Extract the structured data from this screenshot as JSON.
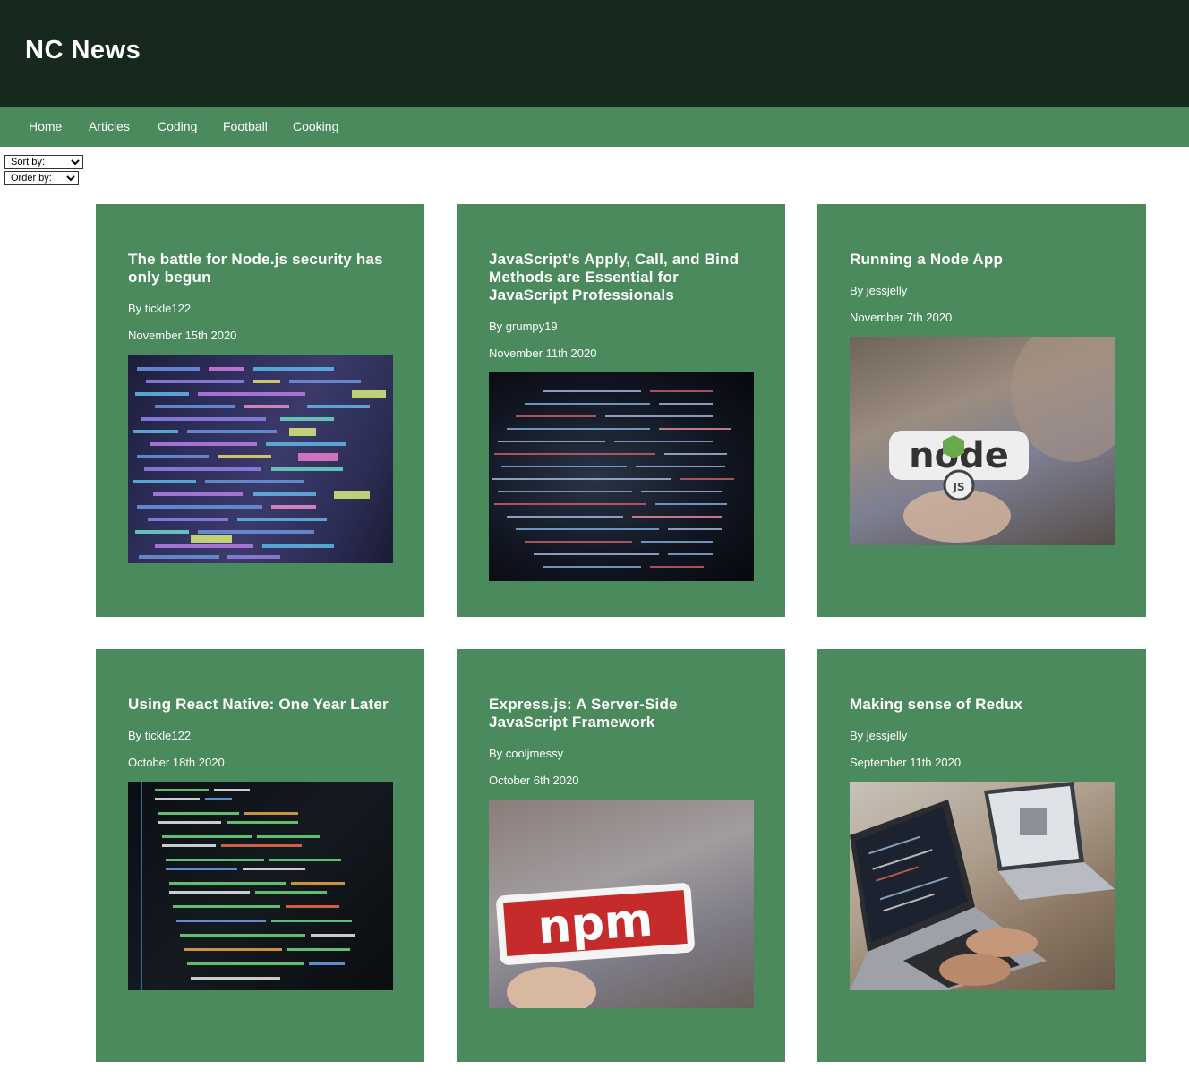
{
  "header": {
    "title": "NC News"
  },
  "nav": {
    "items": [
      "Home",
      "Articles",
      "Coding",
      "Football",
      "Cooking"
    ]
  },
  "controls": {
    "sort_label": "Sort by:",
    "order_label": "Order by:"
  },
  "articles": [
    {
      "title": "The battle for Node.js security has only begun",
      "author": "By tickle122",
      "date": "November 15th 2020",
      "image": "code-screen-image"
    },
    {
      "title": "JavaScript’s Apply, Call, and Bind Methods are Essential for JavaScript Professionals",
      "author": "By grumpy19",
      "date": "November 11th 2020",
      "image": "code-screen-image"
    },
    {
      "title": "Running a Node App",
      "author": "By jessjelly",
      "date": "November 7th 2020",
      "image": "node-sticker-image"
    },
    {
      "title": "Using React Native: One Year Later",
      "author": "By tickle122",
      "date": "October 18th 2020",
      "image": "code-editor-image"
    },
    {
      "title": "Express.js: A Server-Side JavaScript Framework",
      "author": "By cooljmessy",
      "date": "October 6th 2020",
      "image": "npm-sticker-image"
    },
    {
      "title": "Making sense of Redux",
      "author": "By jessjelly",
      "date": "September 11th 2020",
      "image": "laptops-image"
    }
  ],
  "colors": {
    "header_bg": "#17291d",
    "nav_bg": "#4a8a5c",
    "card_bg": "#4a8a5c",
    "text": "#ffffff"
  }
}
